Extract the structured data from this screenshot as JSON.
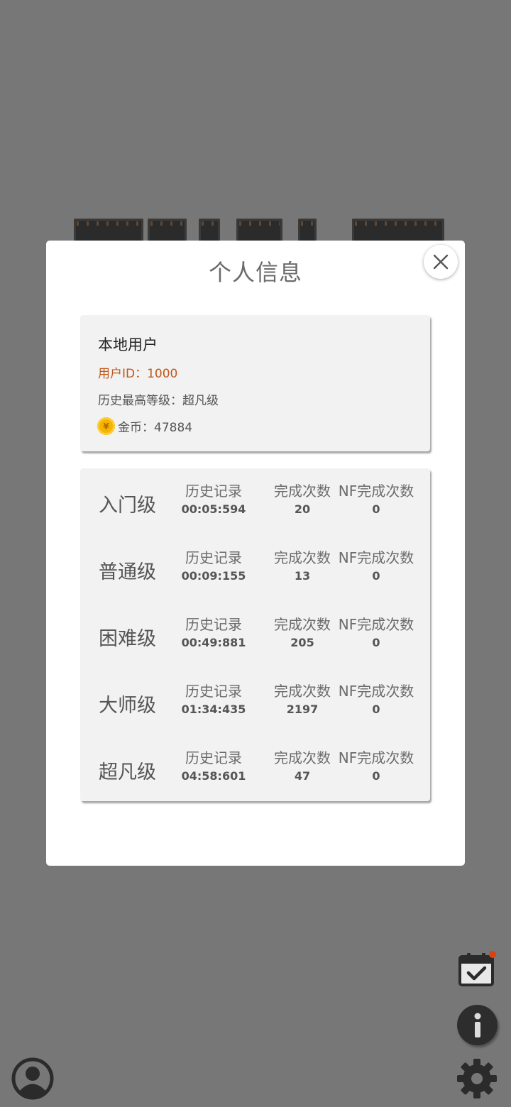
{
  "dialog": {
    "title": "个人信息"
  },
  "user": {
    "name": "本地用户",
    "id_line": "用户ID：1000",
    "best_level_line": "历史最高等级：超凡级",
    "coins_line": "金币：47884",
    "coin_symbol": "¥"
  },
  "stats": {
    "rows": [
      {
        "level": "入门级",
        "record_label": "历史记录",
        "record": "00:05:594",
        "count_label": "完成次数",
        "count": "20",
        "nf_label": "NF完成次数",
        "nf": "0"
      },
      {
        "level": "普通级",
        "record_label": "历史记录",
        "record": "00:09:155",
        "count_label": "完成次数",
        "count": "13",
        "nf_label": "NF完成次数",
        "nf": "0"
      },
      {
        "level": "困难级",
        "record_label": "历史记录",
        "record": "00:49:881",
        "count_label": "完成次数",
        "count": "205",
        "nf_label": "NF完成次数",
        "nf": "0"
      },
      {
        "level": "大师级",
        "record_label": "历史记录",
        "record": "01:34:435",
        "count_label": "完成次数",
        "count": "2197",
        "nf_label": "NF完成次数",
        "nf": "0"
      },
      {
        "level": "超凡级",
        "record_label": "历史记录",
        "record": "04:58:601",
        "count_label": "完成次数",
        "count": "47",
        "nf_label": "NF完成次数",
        "nf": "0"
      }
    ]
  },
  "colors": {
    "overlay": "#777777",
    "accent_id": "#c0581a",
    "coin": "#f4b400",
    "notification_dot": "#d84315"
  },
  "icons": {
    "close": "close-icon",
    "coin": "coin-icon",
    "calendar": "calendar-check-icon",
    "info": "info-icon",
    "settings": "gear-icon",
    "profile": "user-avatar-icon"
  }
}
